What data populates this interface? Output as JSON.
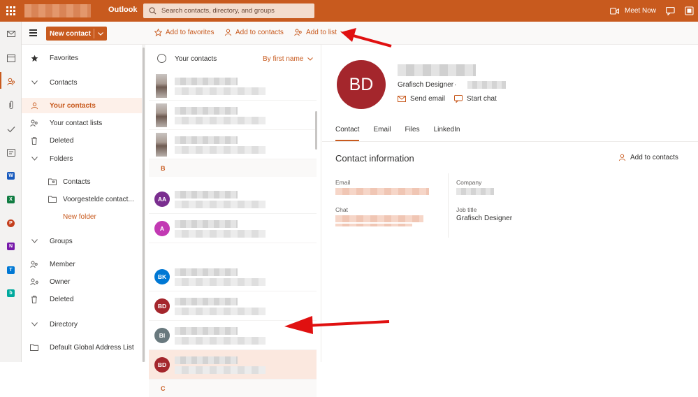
{
  "app": {
    "brand": "Outlook"
  },
  "search": {
    "placeholder": "Search contacts, directory, and groups"
  },
  "header": {
    "meet_now": "Meet Now"
  },
  "toolbar": {
    "new_contact": "New contact",
    "add_to_favorites": "Add to favorites",
    "add_to_contacts": "Add to contacts",
    "add_to_list": "Add to list"
  },
  "nav": {
    "favorites": "Favorites",
    "contacts": "Contacts",
    "your_contacts": "Your contacts",
    "your_contact_lists": "Your contact lists",
    "deleted": "Deleted",
    "folders": "Folders",
    "folder_contacts": "Contacts",
    "folder_suggested": "Voorgestelde contact...",
    "new_folder": "New folder",
    "groups": "Groups",
    "member": "Member",
    "owner": "Owner",
    "groups_deleted": "Deleted",
    "directory": "Directory",
    "gal": "Default Global Address List"
  },
  "list": {
    "title": "Your contacts",
    "sort": "By first name",
    "rows": [
      {
        "initials": "",
        "color": "#a89a92",
        "photo": true
      },
      {
        "initials": "",
        "color": "#6e5b52",
        "photo": true
      },
      {
        "initials": "",
        "color": "#a89a92",
        "photo": true
      },
      {
        "initials": "AA",
        "color": "#7a2e8f"
      },
      {
        "initials": "A",
        "color": "#c239b3"
      },
      {
        "initials": "BK",
        "color": "#0078d4"
      },
      {
        "initials": "BD",
        "color": "#a4262c"
      },
      {
        "initials": "BI",
        "color": "#69797e"
      },
      {
        "initials": "BD",
        "color": "#a4262c"
      }
    ],
    "section_b": "B",
    "section_c": "C"
  },
  "detail": {
    "initials": "BD",
    "role": "Grafisch Designer",
    "send_email": "Send email",
    "start_chat": "Start chat",
    "tabs": [
      "Contact",
      "Email",
      "Files",
      "LinkedIn"
    ],
    "contact_information": "Contact information",
    "add_to_contacts": "Add to contacts",
    "labels": {
      "email": "Email",
      "chat": "Chat",
      "company": "Company",
      "job_title": "Job title"
    },
    "job_title_value": "Grafisch Designer"
  },
  "colors": {
    "accent": "#c85a1e",
    "annotation": "#e01010"
  }
}
